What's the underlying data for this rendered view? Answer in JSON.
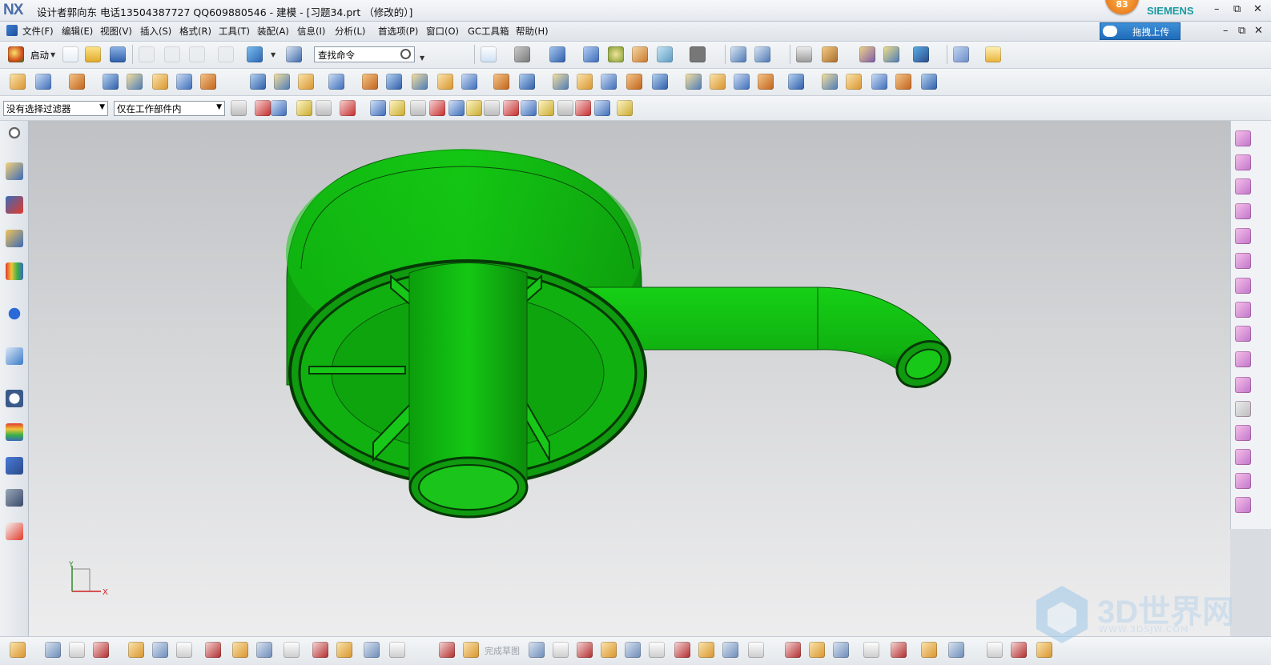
{
  "window": {
    "app_logo": "NX",
    "title": "设计者郭向东  电话13504387727  QQ609880546 - 建模 - [习题34.prt （修改的）]",
    "brand": "SIEMENS",
    "badge_count": "83",
    "controls": [
      "–",
      "⧉",
      "✕"
    ]
  },
  "menubar": {
    "items": [
      "文件(F)",
      "编辑(E)",
      "视图(V)",
      "插入(S)",
      "格式(R)",
      "工具(T)",
      "装配(A)",
      "信息(I)",
      "分析(L)",
      "首选项(P)",
      "窗口(O)",
      "GC工具箱",
      "帮助(H)"
    ],
    "upload_label": "拖拽上传",
    "controls": [
      "–",
      "⧉",
      "✕"
    ]
  },
  "toolbar_standard": {
    "start_label": "启动",
    "search_placeholder": "查找命令"
  },
  "selection_bar": {
    "filter_value": "没有选择过滤器",
    "scope_value": "仅在工作部件内"
  },
  "bottom_toolbar": {
    "finish_sketch_label": "完成草图"
  },
  "triad": {
    "x_label": "X",
    "y_label": "Y"
  },
  "watermark": {
    "text": "3D世界网",
    "url": "WWW.3DSJW.COM"
  },
  "model": {
    "body_color": "#10c010",
    "edge_color": "#0a3f0a"
  },
  "colors": {
    "accent": "#1f6bb8",
    "brand": "#1a9aa0"
  }
}
